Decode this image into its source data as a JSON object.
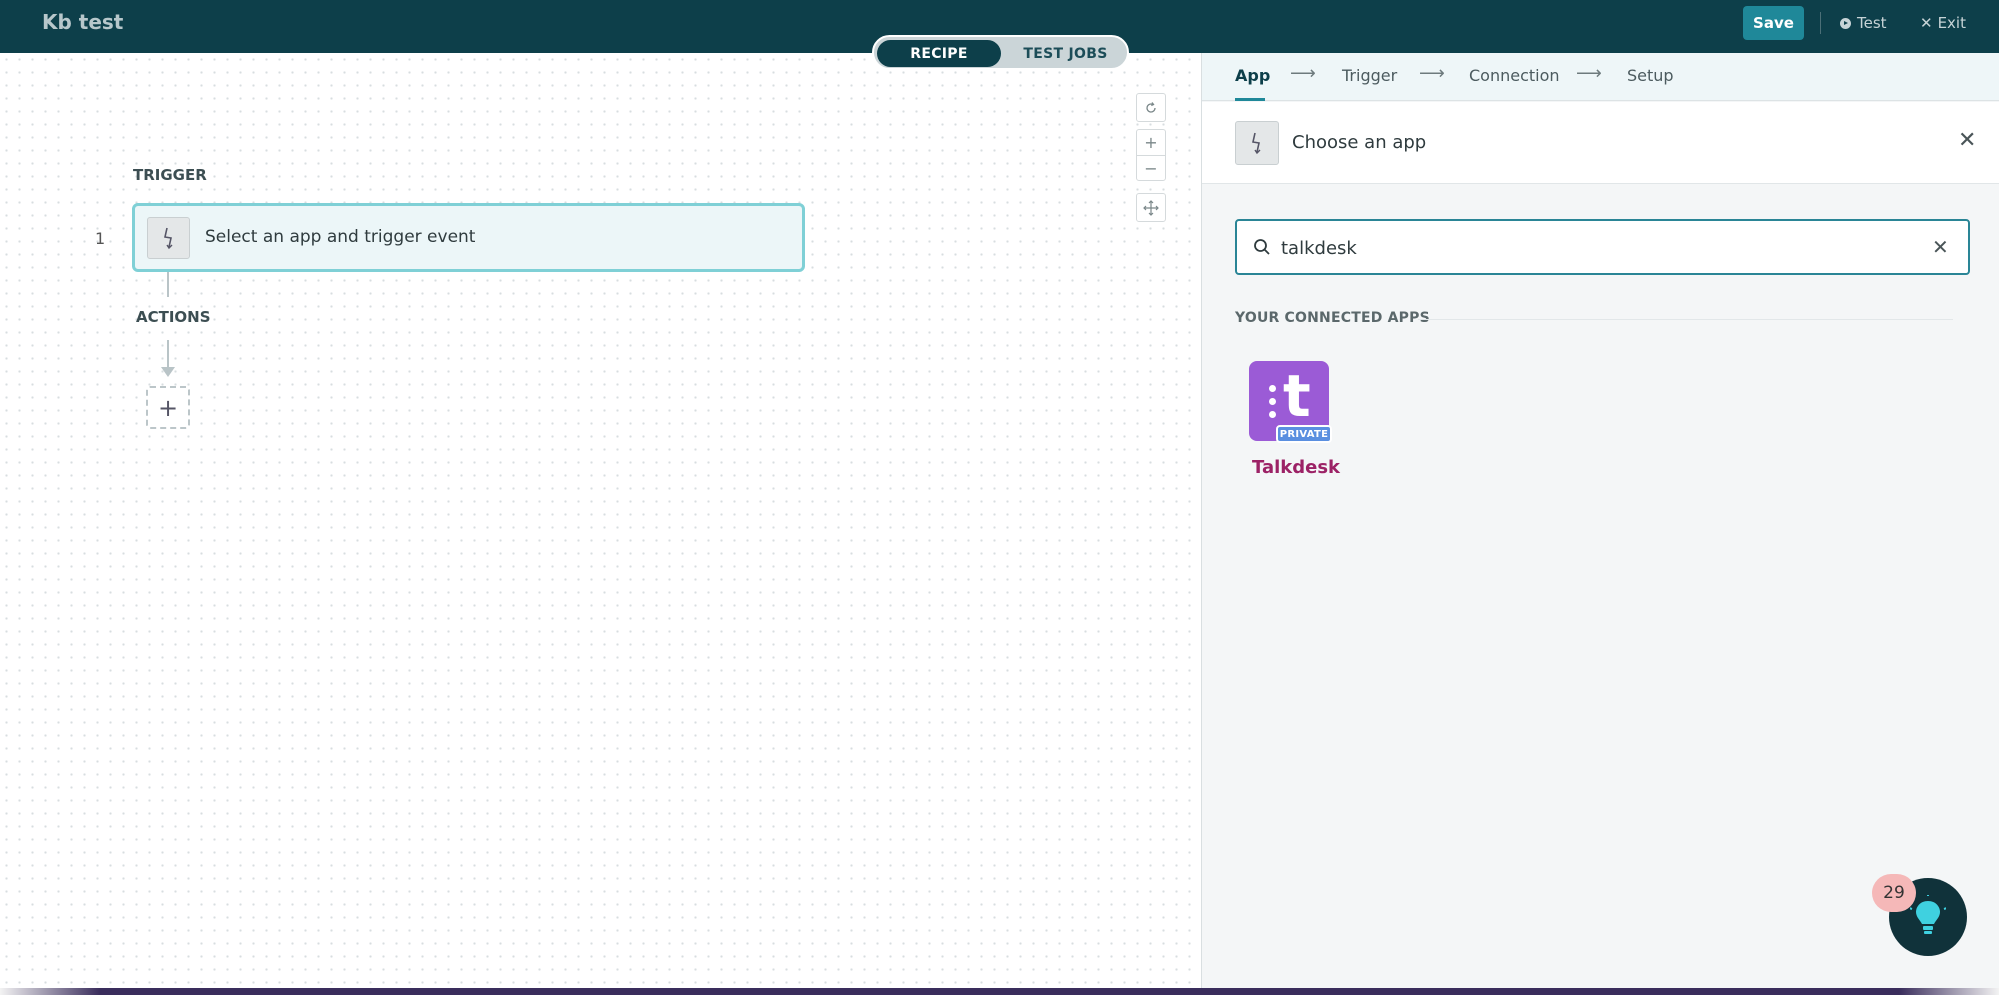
{
  "header": {
    "title": "Kb test",
    "save_label": "Save",
    "test_label": "Test",
    "exit_label": "Exit"
  },
  "view_toggle": {
    "recipe_label": "RECIPE",
    "test_jobs_label": "TEST JOBS",
    "selected": "RECIPE"
  },
  "canvas": {
    "trigger_heading": "TRIGGER",
    "step_number": "1",
    "trigger_text": "Select an app and trigger event",
    "actions_heading": "ACTIONS"
  },
  "panel": {
    "steps": [
      "App",
      "Trigger",
      "Connection",
      "Setup"
    ],
    "active_step": "App",
    "choose_title": "Choose an app",
    "search_value": "talkdesk",
    "section_title": "YOUR CONNECTED APPS",
    "apps": [
      {
        "name": "Talkdesk",
        "badge": "PRIVATE",
        "color": "#9b5bd6"
      }
    ]
  },
  "help": {
    "badge_count": "29"
  },
  "colors": {
    "header_bg": "#0d3f4a",
    "accent": "#1f8899",
    "app_name": "#9c2266"
  }
}
